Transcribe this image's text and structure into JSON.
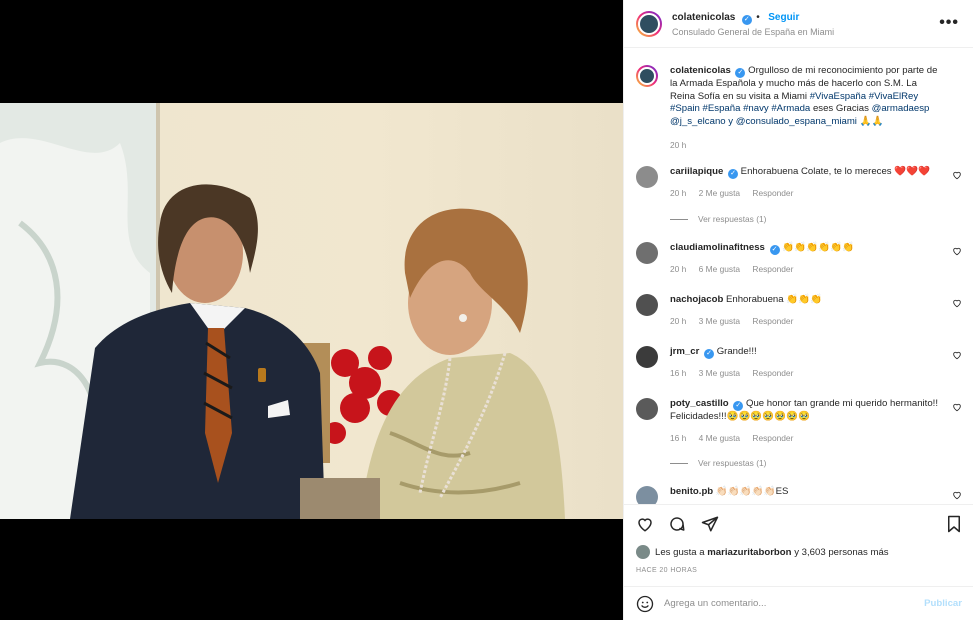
{
  "header": {
    "username": "colatenicolas",
    "follow_label": "Seguir",
    "location": "Consulado General de España en Miami"
  },
  "caption": {
    "username": "colatenicolas",
    "text_main": "Orgulloso de mi reconocimiento por parte de la Armada Española y mucho más de hacerlo con S.M. La Reina Sofía en su visita a Miami",
    "hashtags": "#VivaEspaña #VivaElRey #Spain #España #navy #Armada",
    "text_mid": "eses Gracias",
    "mentions": "@armadaesp @j_s_elcano y @consulado_espana_miami",
    "emoji": "🙏🙏",
    "time": "20 h"
  },
  "comments": [
    {
      "username": "cariilapique",
      "text": "Enhorabuena Colate, te lo mereces ❤️❤️❤️",
      "time": "20 h",
      "likes": "2 Me gusta",
      "reply": "Responder",
      "view_replies": "Ver respuestas (1)"
    },
    {
      "username": "claudiamolinafitness",
      "text": "👏👏👏👏👏👏",
      "time": "20 h",
      "likes": "6 Me gusta",
      "reply": "Responder"
    },
    {
      "username": "nachojacob",
      "text": "Enhorabuena 👏👏👏",
      "time": "20 h",
      "likes": "3 Me gusta",
      "reply": "Responder"
    },
    {
      "username": "jrm_cr",
      "text": "Grande!!!",
      "time": "16 h",
      "likes": "3 Me gusta",
      "reply": "Responder"
    },
    {
      "username": "poty_castillo",
      "text": "Que honor tan grande mi querido hermanito!! Felicidades!!!🥹🥹🥹🥹🥹🥹🥹",
      "time": "16 h",
      "likes": "4 Me gusta",
      "reply": "Responder",
      "view_replies": "Ver respuestas (1)"
    },
    {
      "username": "benito.pb",
      "text": "👏🏻👏🏻👏🏻👏🏻👏🏻ES"
    }
  ],
  "actions": {
    "likes_prefix": "Les gusta a",
    "likes_user": "mariazuritaborbon",
    "likes_suffix": "y 3,603 personas más",
    "time_ago": "HACE 20 HORAS"
  },
  "composer": {
    "placeholder": "Agrega un comentario...",
    "publish": "Publicar"
  },
  "icons": [
    "heart-icon",
    "comment-icon",
    "share-icon",
    "bookmark-icon",
    "more-options-icon",
    "emoji-icon",
    "verified-icon"
  ],
  "colors": {
    "accent": "#0095f6",
    "verified": "#3897f0",
    "muted": "#8e8e8e"
  }
}
